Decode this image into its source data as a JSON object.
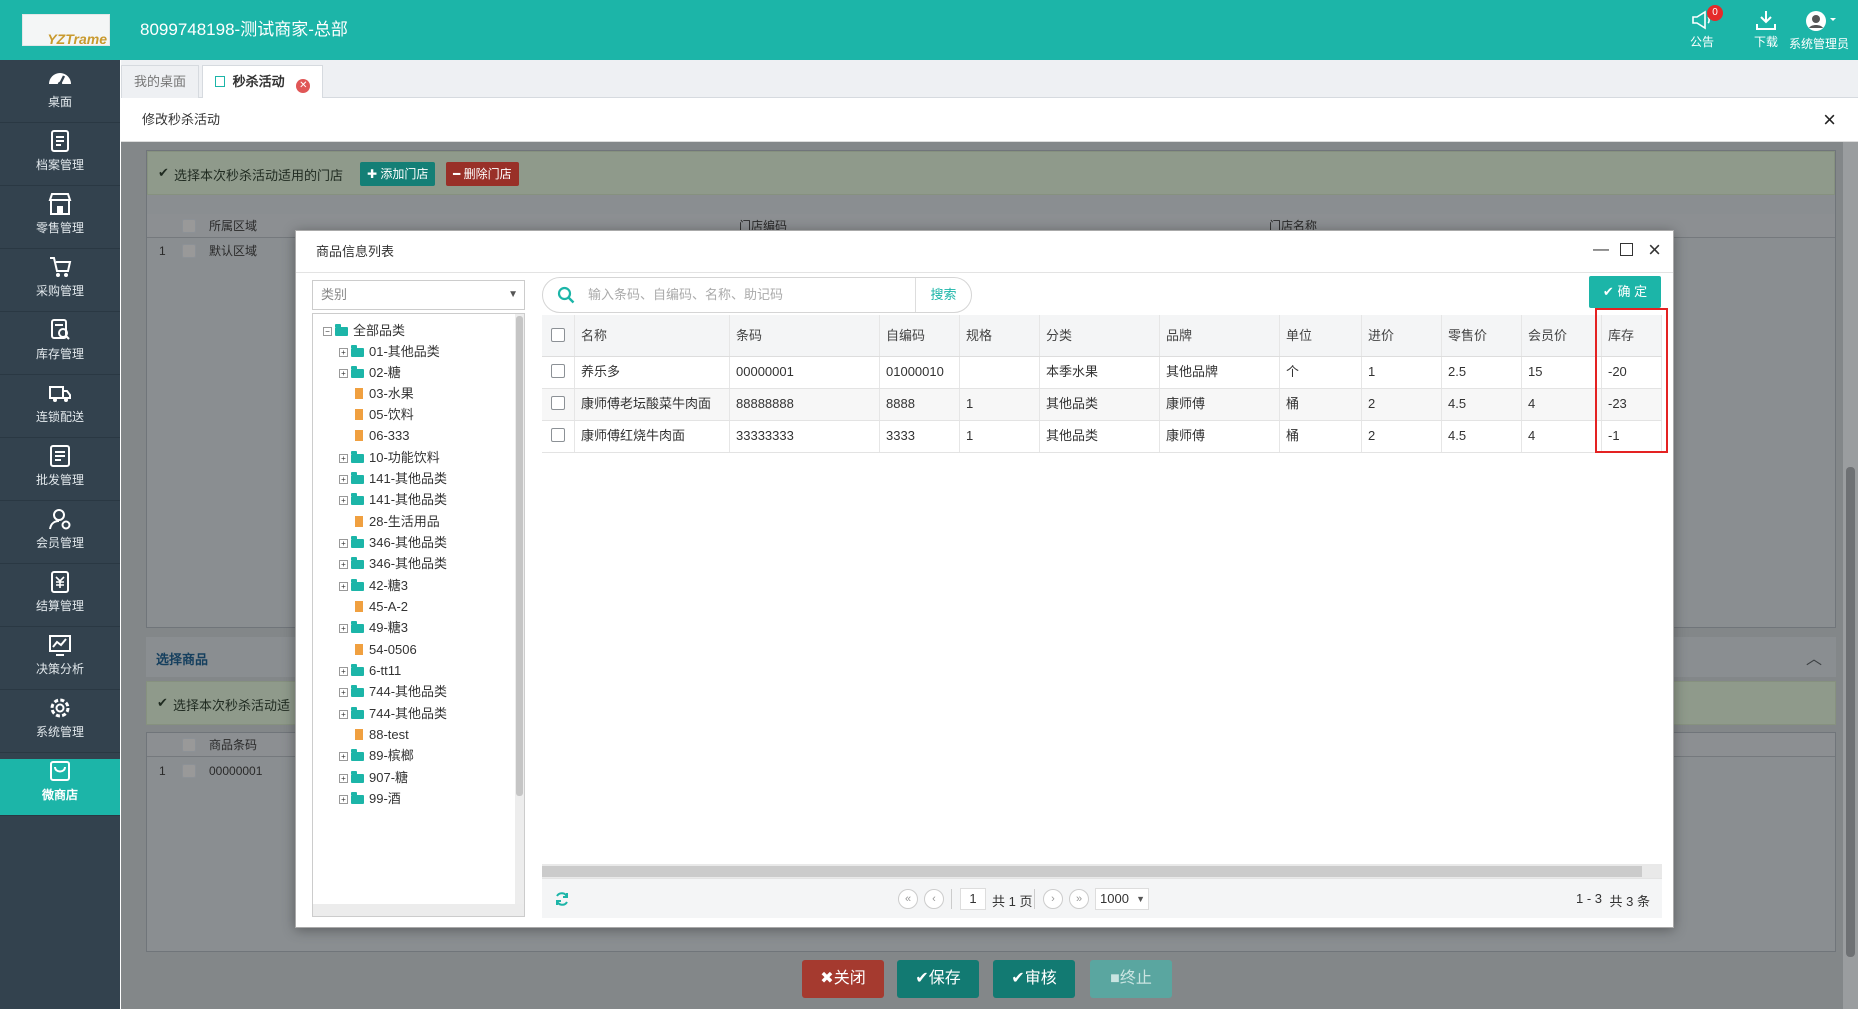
{
  "header": {
    "logo_text": "YZTrame",
    "title": "8099748198-测试商家-总部",
    "announce_label": "公告",
    "announce_count": "0",
    "download_label": "下载",
    "user_label": "系统管理员"
  },
  "sidebar": {
    "items": [
      {
        "label": "桌面",
        "icon": "dashboard-icon"
      },
      {
        "label": "档案管理",
        "icon": "archive-icon"
      },
      {
        "label": "零售管理",
        "icon": "store-icon"
      },
      {
        "label": "采购管理",
        "icon": "purchase-icon"
      },
      {
        "label": "库存管理",
        "icon": "inventory-icon"
      },
      {
        "label": "连锁配送",
        "icon": "delivery-icon"
      },
      {
        "label": "批发管理",
        "icon": "wholesale-icon"
      },
      {
        "label": "会员管理",
        "icon": "member-icon"
      },
      {
        "label": "结算管理",
        "icon": "settlement-icon"
      },
      {
        "label": "决策分析",
        "icon": "analysis-icon"
      },
      {
        "label": "系统管理",
        "icon": "settings-icon"
      },
      {
        "label": "微商店",
        "icon": "shop-bag-icon"
      }
    ],
    "active_index": 11
  },
  "tabs": [
    {
      "label": "我的桌面"
    },
    {
      "label": "秒杀活动"
    }
  ],
  "page": {
    "title": "修改秒杀活动",
    "store_hint": "选择本次秒杀活动适用的门店",
    "add_store": "添加门店",
    "delete_store": "删除门店",
    "store_columns": [
      "所属区域",
      "门店编码",
      "门店名称"
    ],
    "store_rows": [
      {
        "no": "1",
        "area": "默认区域"
      }
    ],
    "goods_section": "选择商品",
    "goods_hint": "选择本次秒杀活动适",
    "goods_columns": [
      "商品条码"
    ],
    "goods_rows": [
      {
        "no": "1",
        "barcode": "00000001"
      }
    ]
  },
  "modal": {
    "title": "商品信息列表",
    "category_placeholder": "类别",
    "search_placeholder": "输入条码、自编码、名称、助记码",
    "search_label": "搜索",
    "confirm_label": "确 定",
    "tree": [
      {
        "label": "全部品类",
        "type": "root"
      },
      {
        "label": "01-其他品类",
        "type": "folder"
      },
      {
        "label": "02-糖",
        "type": "folder"
      },
      {
        "label": "03-水果",
        "type": "file"
      },
      {
        "label": "05-饮料",
        "type": "file"
      },
      {
        "label": "06-333",
        "type": "file"
      },
      {
        "label": "10-功能饮料",
        "type": "folder"
      },
      {
        "label": "141-其他品类",
        "type": "folder"
      },
      {
        "label": "141-其他品类",
        "type": "folder"
      },
      {
        "label": "28-生活用品",
        "type": "file"
      },
      {
        "label": "346-其他品类",
        "type": "folder"
      },
      {
        "label": "346-其他品类",
        "type": "folder"
      },
      {
        "label": "42-糖3",
        "type": "folder"
      },
      {
        "label": "45-A-2",
        "type": "file"
      },
      {
        "label": "49-糖3",
        "type": "folder"
      },
      {
        "label": "54-0506",
        "type": "file"
      },
      {
        "label": "6-tt11",
        "type": "folder"
      },
      {
        "label": "744-其他品类",
        "type": "folder"
      },
      {
        "label": "744-其他品类",
        "type": "folder"
      },
      {
        "label": "88-test",
        "type": "file"
      },
      {
        "label": "89-槟榔",
        "type": "folder"
      },
      {
        "label": "907-糖",
        "type": "folder"
      },
      {
        "label": "99-酒",
        "type": "folder"
      }
    ],
    "columns": [
      "名称",
      "条码",
      "自编码",
      "规格",
      "分类",
      "品牌",
      "单位",
      "进价",
      "零售价",
      "会员价",
      "库存"
    ],
    "rows": [
      [
        "养乐多",
        "00000001",
        "01000010",
        "",
        "本季水果",
        "其他品牌",
        "个",
        "1",
        "2.5",
        "15",
        "-20"
      ],
      [
        "康师傅老坛酸菜牛肉面",
        "88888888",
        "8888",
        "1",
        "其他品类",
        "康师傅",
        "桶",
        "2",
        "4.5",
        "4",
        "-23"
      ],
      [
        "康师傅红烧牛肉面",
        "33333333",
        "3333",
        "1",
        "其他品类",
        "康师傅",
        "桶",
        "2",
        "4.5",
        "4",
        "-1"
      ]
    ],
    "pager": {
      "page": "1",
      "total_pages": "共 1 页",
      "page_size": "1000",
      "range": "1 - 3",
      "total": "共 3 条"
    }
  },
  "footer": {
    "close": "关闭",
    "save": "保存",
    "audit": "审核",
    "stop": "终止"
  },
  "colors": {
    "brand": "#1cb5a8",
    "sidebar": "#33424e",
    "danger": "#d9483b",
    "highlight": "#e42222"
  }
}
